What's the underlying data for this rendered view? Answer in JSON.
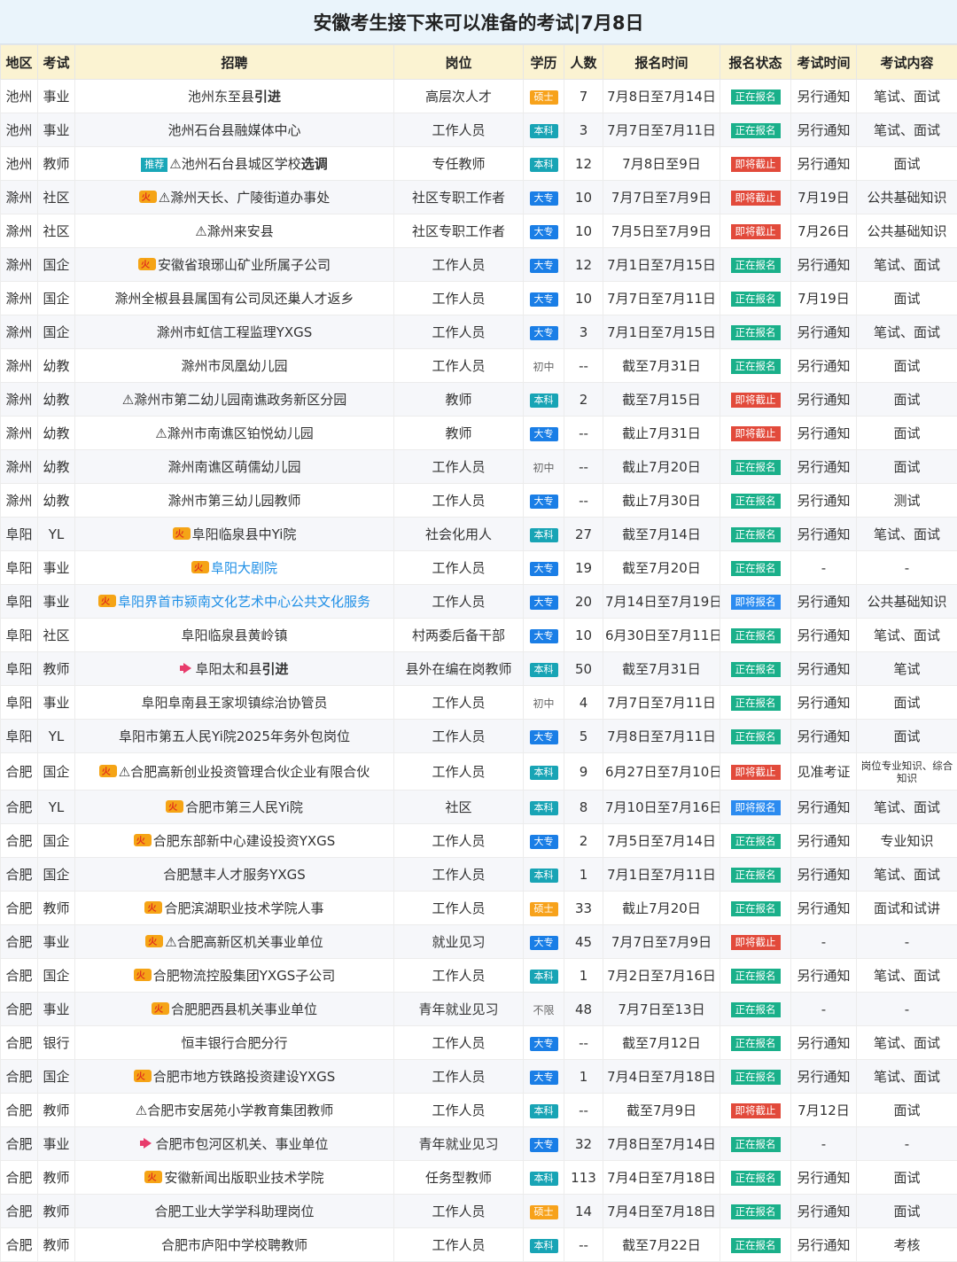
{
  "title": "安徽考生接下来可以准备的考试|7月8日",
  "headers": [
    "地区",
    "考试",
    "招聘",
    "岗位",
    "学历",
    "人数",
    "报名时间",
    "报名状态",
    "考试时间",
    "考试内容"
  ],
  "rows": [
    {
      "region": "池州",
      "type": "事业",
      "pre": "",
      "tag": "",
      "name": "池州东至县",
      "bold": "引进",
      "blue": false,
      "post": "高层次人才",
      "edu": "硕士",
      "num": "7",
      "time": "7月8日至7月14日",
      "status": "正在报名",
      "sc": "green",
      "exam": "另行通知",
      "content": "笔试、面试"
    },
    {
      "region": "池州",
      "type": "事业",
      "pre": "",
      "tag": "",
      "name": "池州石台县融媒体中心",
      "bold": "",
      "blue": false,
      "post": "工作人员",
      "edu": "本科",
      "num": "3",
      "time": "7月7日至7月11日",
      "status": "正在报名",
      "sc": "green",
      "exam": "另行通知",
      "content": "笔试、面试"
    },
    {
      "region": "池州",
      "type": "教师",
      "pre": "tj",
      "tag": "推荐",
      "name": "⚠池州石台县城区学校",
      "bold": "选调",
      "blue": false,
      "post": "专任教师",
      "edu": "本科",
      "num": "12",
      "time": "7月8日至9日",
      "status": "即将截止",
      "sc": "red",
      "exam": "另行通知",
      "content": "面试"
    },
    {
      "region": "滁州",
      "type": "社区",
      "pre": "fire",
      "tag": "",
      "name": "⚠滁州天长、广陵街道办事处",
      "bold": "",
      "blue": false,
      "post": "社区专职工作者",
      "edu": "大专",
      "num": "10",
      "time": "7月7日至7月9日",
      "status": "即将截止",
      "sc": "red",
      "exam": "7月19日",
      "content": "公共基础知识"
    },
    {
      "region": "滁州",
      "type": "社区",
      "pre": "",
      "tag": "",
      "name": "⚠滁州来安县",
      "bold": "",
      "blue": false,
      "post": "社区专职工作者",
      "edu": "大专",
      "num": "10",
      "time": "7月5日至7月9日",
      "status": "即将截止",
      "sc": "red",
      "exam": "7月26日",
      "content": "公共基础知识"
    },
    {
      "region": "滁州",
      "type": "国企",
      "pre": "fire",
      "tag": "",
      "name": "安徽省琅琊山矿业所属子公司",
      "bold": "",
      "blue": false,
      "post": "工作人员",
      "edu": "大专",
      "num": "12",
      "time": "7月1日至7月15日",
      "status": "正在报名",
      "sc": "green",
      "exam": "另行通知",
      "content": "笔试、面试"
    },
    {
      "region": "滁州",
      "type": "国企",
      "pre": "",
      "tag": "",
      "name": "滁州全椒县县属国有公司凤还巢人才返乡",
      "bold": "",
      "blue": false,
      "post": "工作人员",
      "edu": "大专",
      "num": "10",
      "time": "7月7日至7月11日",
      "status": "正在报名",
      "sc": "green",
      "exam": "7月19日",
      "content": "面试"
    },
    {
      "region": "滁州",
      "type": "国企",
      "pre": "",
      "tag": "",
      "name": "滁州市虹信工程监理YXGS",
      "bold": "",
      "blue": false,
      "post": "工作人员",
      "edu": "大专",
      "num": "3",
      "time": "7月1日至7月15日",
      "status": "正在报名",
      "sc": "green",
      "exam": "另行通知",
      "content": "笔试、面试"
    },
    {
      "region": "滁州",
      "type": "幼教",
      "pre": "",
      "tag": "",
      "name": "滁州市凤凰幼儿园",
      "bold": "",
      "blue": false,
      "post": "工作人员",
      "edu": "初中",
      "num": "--",
      "time": "截至7月31日",
      "status": "正在报名",
      "sc": "green",
      "exam": "另行通知",
      "content": "面试"
    },
    {
      "region": "滁州",
      "type": "幼教",
      "pre": "",
      "tag": "",
      "name": "⚠滁州市第二幼儿园南谯政务新区分园",
      "bold": "",
      "blue": false,
      "post": "教师",
      "edu": "本科",
      "num": "2",
      "time": "截至7月15日",
      "status": "即将截止",
      "sc": "red",
      "exam": "另行通知",
      "content": "面试"
    },
    {
      "region": "滁州",
      "type": "幼教",
      "pre": "",
      "tag": "",
      "name": "⚠滁州市南谯区铂悦幼儿园",
      "bold": "",
      "blue": false,
      "post": "教师",
      "edu": "大专",
      "num": "--",
      "time": "截止7月31日",
      "status": "即将截止",
      "sc": "red",
      "exam": "另行通知",
      "content": "面试"
    },
    {
      "region": "滁州",
      "type": "幼教",
      "pre": "",
      "tag": "",
      "name": "滁州南谯区萌儒幼儿园",
      "bold": "",
      "blue": false,
      "post": "工作人员",
      "edu": "初中",
      "num": "--",
      "time": "截止7月20日",
      "status": "正在报名",
      "sc": "green",
      "exam": "另行通知",
      "content": "面试"
    },
    {
      "region": "滁州",
      "type": "幼教",
      "pre": "",
      "tag": "",
      "name": "滁州市第三幼儿园教师",
      "bold": "",
      "blue": false,
      "post": "工作人员",
      "edu": "大专",
      "num": "--",
      "time": "截止7月30日",
      "status": "正在报名",
      "sc": "green",
      "exam": "另行通知",
      "content": "测试"
    },
    {
      "region": "阜阳",
      "type": "YL",
      "pre": "fire",
      "tag": "",
      "name": "阜阳临泉县中Yi院",
      "bold": "",
      "blue": false,
      "post": "社会化用人",
      "edu": "本科",
      "num": "27",
      "time": "截至7月14日",
      "status": "正在报名",
      "sc": "green",
      "exam": "另行通知",
      "content": "笔试、面试"
    },
    {
      "region": "阜阳",
      "type": "事业",
      "pre": "fire",
      "tag": "",
      "name": "阜阳大剧院",
      "bold": "",
      "blue": true,
      "post": "工作人员",
      "edu": "大专",
      "num": "19",
      "time": "截至7月20日",
      "status": "正在报名",
      "sc": "green",
      "exam": "-",
      "content": "-"
    },
    {
      "region": "阜阳",
      "type": "事业",
      "pre": "fire",
      "tag": "",
      "name": "阜阳界首市颍南文化艺术中心公共文化服务",
      "bold": "",
      "blue": true,
      "post": "工作人员",
      "edu": "大专",
      "num": "20",
      "time": "7月14日至7月19日",
      "status": "即将报名",
      "sc": "blue",
      "exam": "另行通知",
      "content": "公共基础知识"
    },
    {
      "region": "阜阳",
      "type": "社区",
      "pre": "",
      "tag": "",
      "name": "阜阳临泉县黄岭镇",
      "bold": "",
      "blue": false,
      "post": "村两委后备干部",
      "edu": "大专",
      "num": "10",
      "time": "6月30日至7月11日",
      "status": "正在报名",
      "sc": "green",
      "exam": "另行通知",
      "content": "笔试、面试"
    },
    {
      "region": "阜阳",
      "type": "教师",
      "pre": "horn",
      "tag": "",
      "name": "阜阳太和县",
      "bold": "引进",
      "blue": false,
      "post": "县外在编在岗教师",
      "edu": "本科",
      "num": "50",
      "time": "截至7月31日",
      "status": "正在报名",
      "sc": "green",
      "exam": "另行通知",
      "content": "笔试"
    },
    {
      "region": "阜阳",
      "type": "事业",
      "pre": "",
      "tag": "",
      "name": "阜阳阜南县王家坝镇综治协管员",
      "bold": "",
      "blue": false,
      "post": "工作人员",
      "edu": "初中",
      "num": "4",
      "time": "7月7日至7月11日",
      "status": "正在报名",
      "sc": "green",
      "exam": "另行通知",
      "content": "面试"
    },
    {
      "region": "阜阳",
      "type": "YL",
      "pre": "",
      "tag": "",
      "name": "阜阳市第五人民Yi院2025年务外包岗位",
      "bold": "",
      "blue": false,
      "post": "工作人员",
      "edu": "大专",
      "num": "5",
      "time": "7月8日至7月11日",
      "status": "正在报名",
      "sc": "green",
      "exam": "另行通知",
      "content": "面试"
    },
    {
      "region": "合肥",
      "type": "国企",
      "pre": "fire",
      "tag": "",
      "name": "⚠合肥高新创业投资管理合伙企业有限合伙",
      "bold": "",
      "blue": false,
      "post": "工作人员",
      "edu": "本科",
      "num": "9",
      "time": "6月27日至7月10日",
      "status": "即将截止",
      "sc": "red",
      "exam": "见准考证",
      "content": "岗位专业知识、综合知识",
      "tall": true
    },
    {
      "region": "合肥",
      "type": "YL",
      "pre": "fire",
      "tag": "",
      "name": "合肥市第三人民Yi院",
      "bold": "",
      "blue": false,
      "post": "社区",
      "edu": "本科",
      "num": "8",
      "time": "7月10日至7月16日",
      "status": "即将报名",
      "sc": "blue",
      "exam": "另行通知",
      "content": "笔试、面试"
    },
    {
      "region": "合肥",
      "type": "国企",
      "pre": "fire",
      "tag": "",
      "name": "合肥东部新中心建设投资YXGS",
      "bold": "",
      "blue": false,
      "post": "工作人员",
      "edu": "大专",
      "num": "2",
      "time": "7月5日至7月14日",
      "status": "正在报名",
      "sc": "green",
      "exam": "另行通知",
      "content": "专业知识"
    },
    {
      "region": "合肥",
      "type": "国企",
      "pre": "",
      "tag": "",
      "name": "合肥慧丰人才服务YXGS",
      "bold": "",
      "blue": false,
      "post": "工作人员",
      "edu": "本科",
      "num": "1",
      "time": "7月1日至7月11日",
      "status": "正在报名",
      "sc": "green",
      "exam": "另行通知",
      "content": "笔试、面试"
    },
    {
      "region": "合肥",
      "type": "教师",
      "pre": "fire",
      "tag": "",
      "name": "合肥滨湖职业技术学院人事",
      "bold": "",
      "blue": false,
      "post": "工作人员",
      "edu": "硕士",
      "num": "33",
      "time": "截止7月20日",
      "status": "正在报名",
      "sc": "green",
      "exam": "另行通知",
      "content": "面试和试讲"
    },
    {
      "region": "合肥",
      "type": "事业",
      "pre": "fire",
      "tag": "",
      "name": "⚠合肥高新区机关事业单位",
      "bold": "",
      "blue": false,
      "post": "就业见习",
      "edu": "大专",
      "num": "45",
      "time": "7月7日至7月9日",
      "status": "即将截止",
      "sc": "red",
      "exam": "-",
      "content": "-"
    },
    {
      "region": "合肥",
      "type": "国企",
      "pre": "fire",
      "tag": "",
      "name": "合肥物流控股集团YXGS子公司",
      "bold": "",
      "blue": false,
      "post": "工作人员",
      "edu": "本科",
      "num": "1",
      "time": "7月2日至7月16日",
      "status": "正在报名",
      "sc": "green",
      "exam": "另行通知",
      "content": "笔试、面试"
    },
    {
      "region": "合肥",
      "type": "事业",
      "pre": "fire",
      "tag": "",
      "name": "合肥肥西县机关事业单位",
      "bold": "",
      "blue": false,
      "post": "青年就业见习",
      "edu": "不限",
      "num": "48",
      "time": "7月7日至13日",
      "status": "正在报名",
      "sc": "green",
      "exam": "-",
      "content": "-"
    },
    {
      "region": "合肥",
      "type": "银行",
      "pre": "",
      "tag": "",
      "name": "恒丰银行合肥分行",
      "bold": "",
      "blue": false,
      "post": "工作人员",
      "edu": "大专",
      "num": "--",
      "time": "截至7月12日",
      "status": "正在报名",
      "sc": "green",
      "exam": "另行通知",
      "content": "笔试、面试"
    },
    {
      "region": "合肥",
      "type": "国企",
      "pre": "fire",
      "tag": "",
      "name": "合肥市地方铁路投资建设YXGS",
      "bold": "",
      "blue": false,
      "post": "工作人员",
      "edu": "大专",
      "num": "1",
      "time": "7月4日至7月18日",
      "status": "正在报名",
      "sc": "green",
      "exam": "另行通知",
      "content": "笔试、面试"
    },
    {
      "region": "合肥",
      "type": "教师",
      "pre": "",
      "tag": "",
      "name": "⚠合肥市安居苑小学教育集团教师",
      "bold": "",
      "blue": false,
      "post": "工作人员",
      "edu": "本科",
      "num": "--",
      "time": "截至7月9日",
      "status": "即将截止",
      "sc": "red",
      "exam": "7月12日",
      "content": "面试"
    },
    {
      "region": "合肥",
      "type": "事业",
      "pre": "horn",
      "tag": "",
      "name": "合肥市包河区机关、事业单位",
      "bold": "",
      "blue": false,
      "post": "青年就业见习",
      "edu": "大专",
      "num": "32",
      "time": "7月8日至7月14日",
      "status": "正在报名",
      "sc": "green",
      "exam": "-",
      "content": "-"
    },
    {
      "region": "合肥",
      "type": "教师",
      "pre": "fire",
      "tag": "",
      "name": "安徽新闻出版职业技术学院",
      "bold": "",
      "blue": false,
      "post": "任务型教师",
      "edu": "本科",
      "num": "113",
      "time": "7月4日至7月18日",
      "status": "正在报名",
      "sc": "green",
      "exam": "另行通知",
      "content": "面试"
    },
    {
      "region": "合肥",
      "type": "教师",
      "pre": "",
      "tag": "",
      "name": "合肥工业大学学科助理岗位",
      "bold": "",
      "blue": false,
      "post": "工作人员",
      "edu": "硕士",
      "num": "14",
      "time": "7月4日至7月18日",
      "status": "正在报名",
      "sc": "green",
      "exam": "另行通知",
      "content": "面试"
    },
    {
      "region": "合肥",
      "type": "教师",
      "pre": "",
      "tag": "",
      "name": "合肥市庐阳中学校聘教师",
      "bold": "",
      "blue": false,
      "post": "工作人员",
      "edu": "本科",
      "num": "--",
      "time": "截至7月22日",
      "status": "正在报名",
      "sc": "green",
      "exam": "另行通知",
      "content": "考核"
    }
  ]
}
